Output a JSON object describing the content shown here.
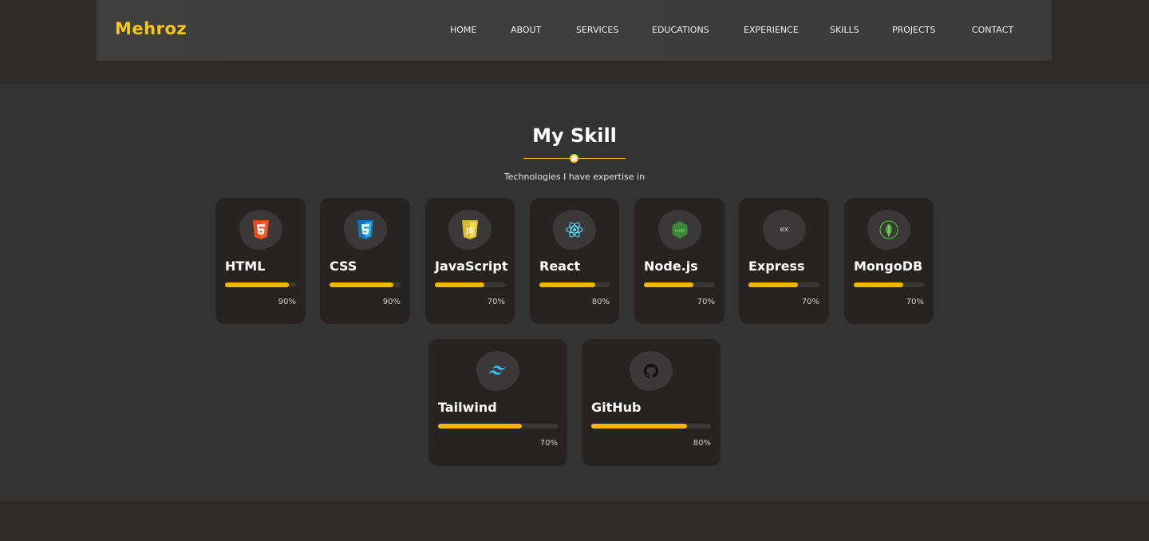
{
  "nav": {
    "logo": "Mehroz",
    "links": [
      "HOME",
      "ABOUT",
      "SERVICES",
      "EDUCATIONS",
      "EXPERIENCE",
      "SKILLS",
      "PROJECTS",
      "CONTACT"
    ]
  },
  "skills_section": {
    "title": "My Skill",
    "subtitle": "Technologies I have expertise in"
  },
  "colors": {
    "accent": "#f6c915",
    "bar": "#f7b500",
    "card": "#262322"
  },
  "skills": [
    {
      "name": "HTML",
      "percent_label": "90%",
      "level": 0.9,
      "icon": "html5-icon"
    },
    {
      "name": "CSS",
      "percent_label": "90%",
      "level": 0.9,
      "icon": "css3-icon"
    },
    {
      "name": "JavaScript",
      "percent_label": "70%",
      "level": 0.7,
      "icon": "javascript-icon"
    },
    {
      "name": "React",
      "percent_label": "80%",
      "level": 0.8,
      "icon": "react-icon"
    },
    {
      "name": "Node.js",
      "percent_label": "70%",
      "level": 0.7,
      "icon": "nodejs-icon"
    },
    {
      "name": "Express",
      "percent_label": "70%",
      "level": 0.7,
      "icon": "express-icon"
    },
    {
      "name": "MongoDB",
      "percent_label": "70%",
      "level": 0.7,
      "icon": "mongodb-icon"
    },
    {
      "name": "Tailwind",
      "percent_label": "70%",
      "level": 0.7,
      "icon": "tailwind-icon"
    },
    {
      "name": "GitHub",
      "percent_label": "80%",
      "level": 0.8,
      "icon": "github-icon"
    }
  ],
  "express_icon_text": "ex"
}
